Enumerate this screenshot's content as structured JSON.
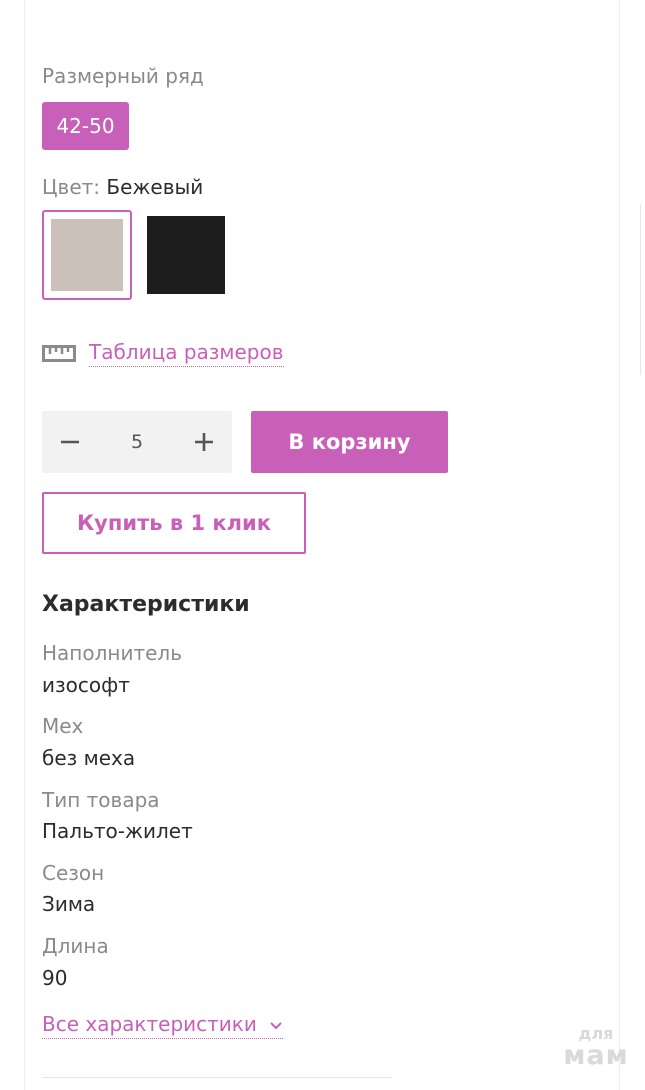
{
  "size_range": {
    "label": "Размерный ряд",
    "selected": "42-50"
  },
  "color": {
    "label": "Цвет:",
    "selected_name": "Бежевый",
    "swatches": [
      {
        "name": "beige",
        "hex": "#cbc0ba",
        "selected": true
      },
      {
        "name": "black",
        "hex": "#1d1d1d",
        "selected": false
      }
    ]
  },
  "size_table": {
    "icon": "ruler-icon",
    "link_text": "Таблица размеров"
  },
  "quantity": {
    "value": "5",
    "minus_icon": "minus-icon",
    "plus_icon": "plus-icon"
  },
  "buttons": {
    "add_to_cart": "В корзину",
    "buy_one_click": "Купить в 1 клик"
  },
  "characteristics": {
    "title": "Характеристики",
    "items": [
      {
        "label": "Наполнитель",
        "value": "изософт"
      },
      {
        "label": "Мех",
        "value": "без меха"
      },
      {
        "label": "Тип товара",
        "value": "Пальто-жилет"
      },
      {
        "label": "Сезон",
        "value": "Зима"
      },
      {
        "label": "Длина",
        "value": "90"
      }
    ],
    "all_link": "Все характеристики"
  },
  "watermark": {
    "top": "для",
    "bottom": "мам"
  },
  "colors": {
    "accent": "#c860b9",
    "stepper_bg": "#f2f2f2",
    "label_gray": "#8a8a8a",
    "text_dark": "#2c2c2c"
  }
}
